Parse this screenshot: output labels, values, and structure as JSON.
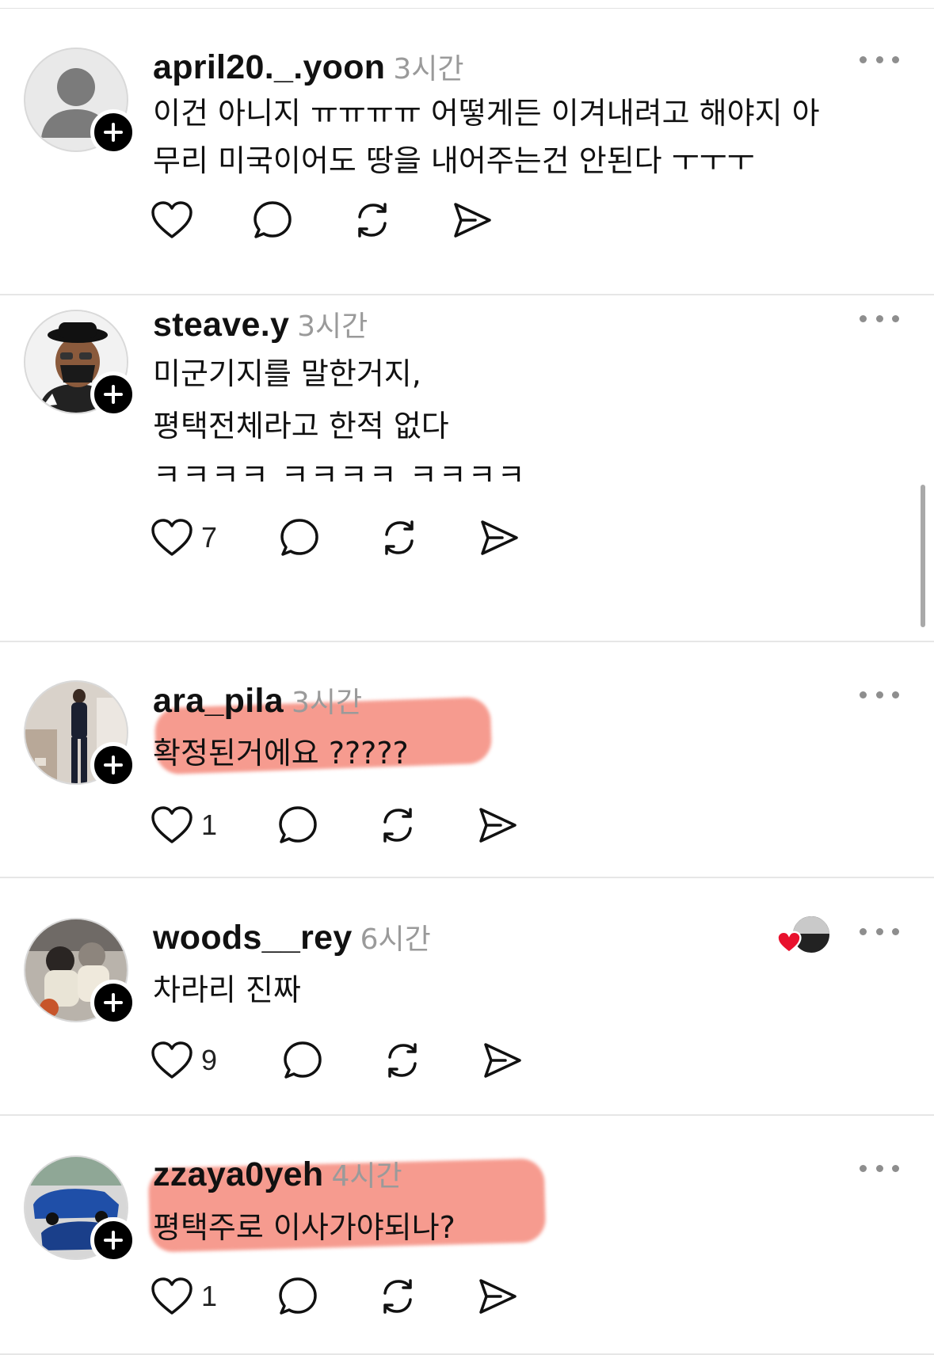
{
  "posts": [
    {
      "username": "april20._.yoon",
      "time": "3시간",
      "lines": [
        "이건 아니지 ㅠㅠㅠㅠ 어떻게든 이겨내려고 해야지 아",
        "무리 미국이어도 땅을 내어주는건 안된다 ㅜㅜㅜ"
      ],
      "like_count": "",
      "avatar": "default-person-avatar"
    },
    {
      "username": "steave.y",
      "time": "3시간",
      "lines": [
        "미군기지를 말한거지,",
        "평택전체라고 한적 없다",
        "ㅋㅋㅋㅋ ㅋㅋㅋㅋ ㅋㅋㅋㅋ"
      ],
      "like_count": "7",
      "avatar": "person-with-hat-mask-photo"
    },
    {
      "username": "ara_pila",
      "time": "3시간",
      "lines": [
        "확정된거에요 ?????"
      ],
      "like_count": "1",
      "avatar": "woman-standing-photo"
    },
    {
      "username": "woods__rey",
      "time": "6시간",
      "lines": [
        "차라리 진짜"
      ],
      "like_count": "9",
      "avatar": "two-dogs-photo",
      "liked_by_author": true
    },
    {
      "username": "zzaya0yeh",
      "time": "4시간",
      "lines": [
        "평택주로 이사가야되나?"
      ],
      "like_count": "1",
      "avatar": "blue-car-photo"
    }
  ],
  "colors": {
    "highlight": "#f58a7c",
    "heart_red": "#e8112d",
    "text": "#111111",
    "muted": "#9a9a9a"
  },
  "icons": [
    "heart-icon",
    "comment-icon",
    "repost-icon",
    "share-icon",
    "more-icon",
    "plus-icon"
  ]
}
